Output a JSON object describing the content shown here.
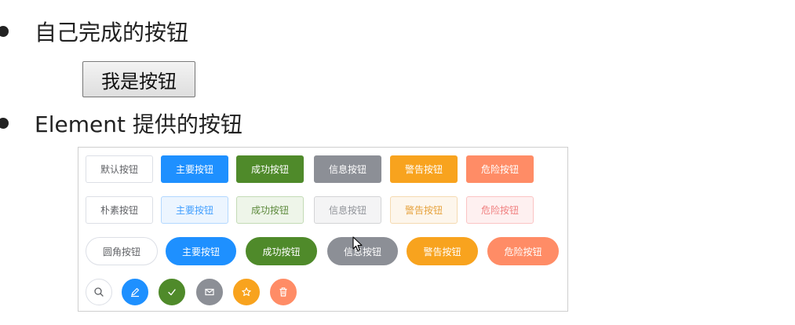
{
  "bullets": [
    {
      "text": "自己完成的按钮"
    },
    {
      "text": "Element 提供的按钮"
    }
  ],
  "native_button": {
    "label": "我是按钮"
  },
  "element_demo": {
    "basic": [
      "默认按钮",
      "主要按钮",
      "成功按钮",
      "信息按钮",
      "警告按钮",
      "危险按钮"
    ],
    "plain": [
      "朴素按钮",
      "主要按钮",
      "成功按钮",
      "信息按钮",
      "警告按钮",
      "危险按钮"
    ],
    "round": [
      "圆角按钮",
      "主要按钮",
      "成功按钮",
      "信息按钮",
      "警告按钮",
      "危险按钮"
    ],
    "circle_icons": [
      "search-icon",
      "edit-icon",
      "check-icon",
      "message-icon",
      "star-icon",
      "delete-icon"
    ]
  },
  "colors": {
    "primary": "#1e90ff",
    "success": "#4f8a2a",
    "info": "#8c8f96",
    "warning": "#f8a31e",
    "danger": "#ff8c66"
  }
}
